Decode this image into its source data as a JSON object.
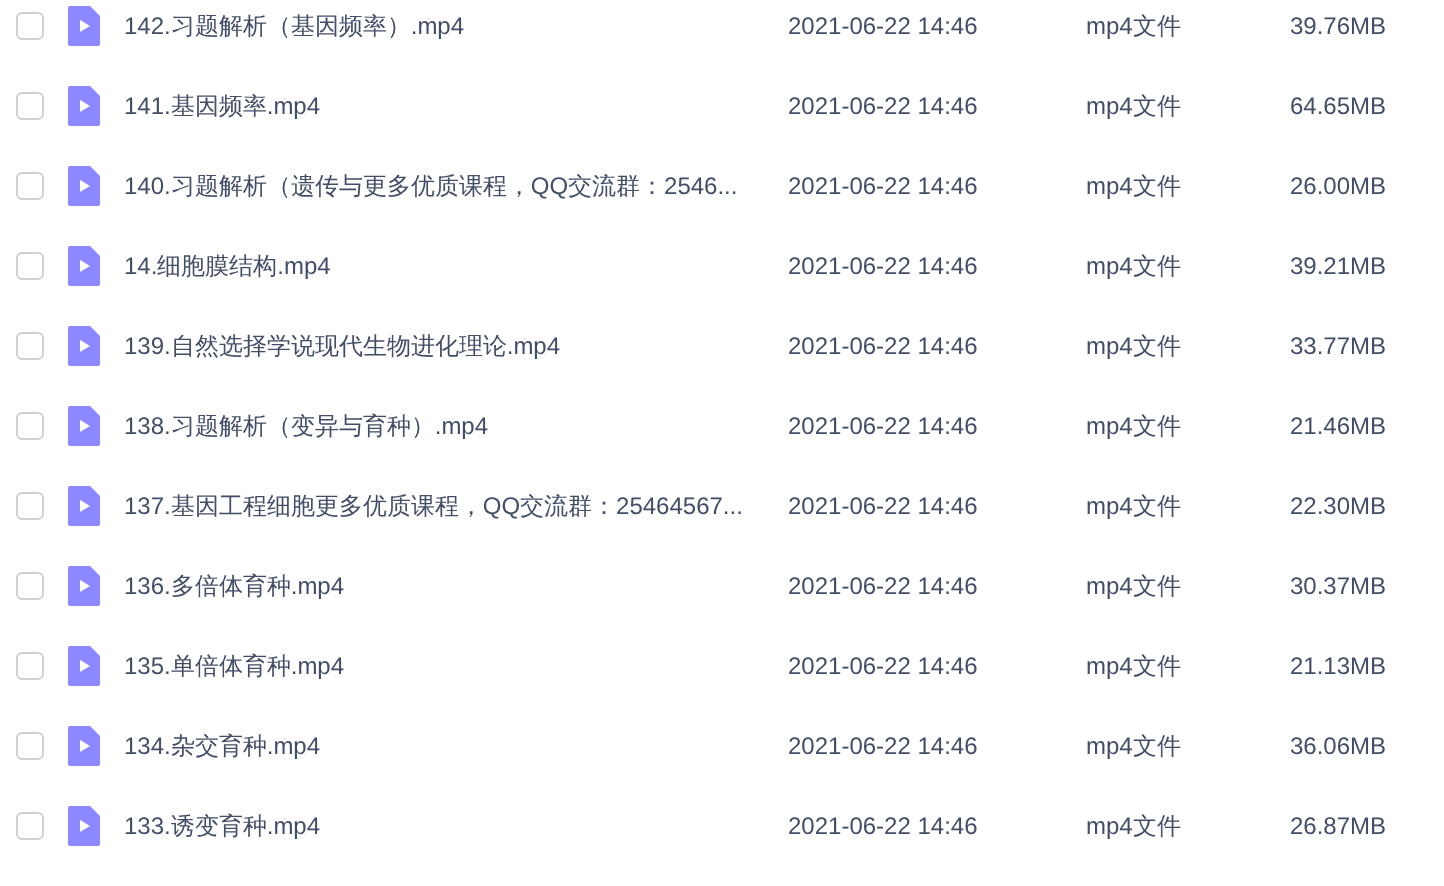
{
  "files": [
    {
      "name": "142.习题解析（基因频率）.mp4",
      "date": "2021-06-22 14:46",
      "type": "mp4文件",
      "size": "39.76MB",
      "checked": false
    },
    {
      "name": "141.基因频率.mp4",
      "date": "2021-06-22 14:46",
      "type": "mp4文件",
      "size": "64.65MB",
      "checked": false
    },
    {
      "name": "140.习题解析（遗传与更多优质课程，QQ交流群：2546...",
      "date": "2021-06-22 14:46",
      "type": "mp4文件",
      "size": "26.00MB",
      "checked": false
    },
    {
      "name": "14.细胞膜结构.mp4",
      "date": "2021-06-22 14:46",
      "type": "mp4文件",
      "size": "39.21MB",
      "checked": false
    },
    {
      "name": "139.自然选择学说现代生物进化理论.mp4",
      "date": "2021-06-22 14:46",
      "type": "mp4文件",
      "size": "33.77MB",
      "checked": false
    },
    {
      "name": "138.习题解析（变异与育种）.mp4",
      "date": "2021-06-22 14:46",
      "type": "mp4文件",
      "size": "21.46MB",
      "checked": false
    },
    {
      "name": "137.基因工程细胞更多优质课程，QQ交流群：25464567...",
      "date": "2021-06-22 14:46",
      "type": "mp4文件",
      "size": "22.30MB",
      "checked": false
    },
    {
      "name": "136.多倍体育种.mp4",
      "date": "2021-06-22 14:46",
      "type": "mp4文件",
      "size": "30.37MB",
      "checked": false
    },
    {
      "name": "135.单倍体育种.mp4",
      "date": "2021-06-22 14:46",
      "type": "mp4文件",
      "size": "21.13MB",
      "checked": false
    },
    {
      "name": "134.杂交育种.mp4",
      "date": "2021-06-22 14:46",
      "type": "mp4文件",
      "size": "36.06MB",
      "checked": false
    },
    {
      "name": "133.诱变育种.mp4",
      "date": "2021-06-22 14:46",
      "type": "mp4文件",
      "size": "26.87MB",
      "checked": false
    }
  ]
}
